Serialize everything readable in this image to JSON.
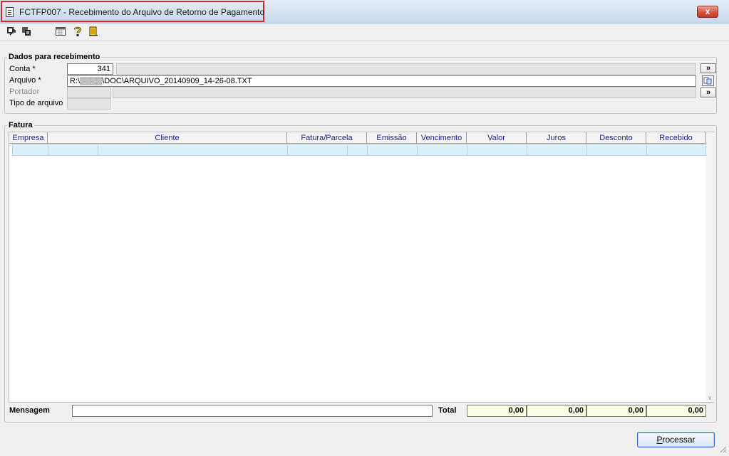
{
  "window": {
    "title": "FCTFP007 - Recebimento do Arquivo de Retorno de Pagamento",
    "close_glyph": "x",
    "close_color": "#c94a35"
  },
  "toolbar": {
    "icons": [
      "arrow-in-icon",
      "copy-icon",
      "calendar-icon",
      "help-icon",
      "exit-door-icon"
    ]
  },
  "dados": {
    "legend": "Dados para recebimento",
    "conta_label": "Conta *",
    "conta_value": "341",
    "arquivo_label": "Arquivo *",
    "arquivo_value": "R:\\▒▒▒▒\\DOC\\ARQUIVO_20140909_14-26-08.TXT",
    "portador_label": "Portador",
    "tipo_label": "Tipo de arquivo",
    "more_glyph": "»"
  },
  "fatura": {
    "legend": "Fatura",
    "columns": [
      "Empresa",
      "Cliente",
      "Fatura/Parcela",
      "Emissão",
      "Vencimento",
      "Valor",
      "Juros",
      "Desconto",
      "Recebido"
    ],
    "header_color": "#1c1c9c",
    "row_color": "#dcf0fa"
  },
  "footer": {
    "mensagem_label": "Mensagem",
    "total_label": "Total",
    "totals": [
      "0,00",
      "0,00",
      "0,00",
      "0,00"
    ]
  },
  "actions": {
    "processar_first": "P",
    "processar_rest": "rocessar"
  }
}
